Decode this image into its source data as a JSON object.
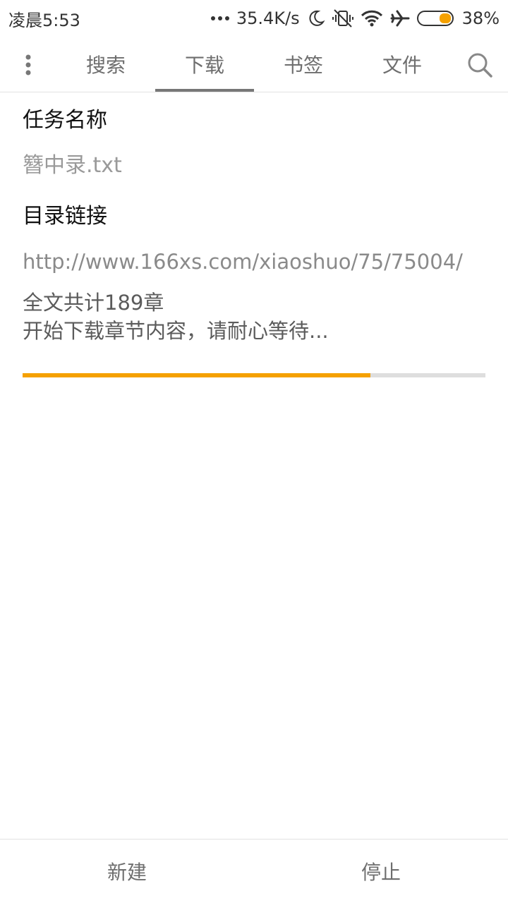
{
  "status_bar": {
    "time": "凌晨5:53",
    "net_speed": "35.4K/s",
    "battery_percent": "38%",
    "battery_level": 0.38,
    "icons": [
      "more-dots-icon",
      "moon-icon",
      "vibrate-off-icon",
      "wifi-icon",
      "airplane-icon",
      "battery-icon"
    ],
    "accent": "#f5a100"
  },
  "tabs": {
    "items": [
      {
        "label": "搜索"
      },
      {
        "label": "下载"
      },
      {
        "label": "书签"
      },
      {
        "label": "文件"
      }
    ],
    "active_index": 1,
    "menu_icon": "more-vertical-icon",
    "search_icon": "search-icon"
  },
  "task": {
    "name_label": "任务名称",
    "name_value": "簪中录.txt",
    "url_label": "目录链接",
    "url_value": "http://www.166xs.com/xiaoshuo/75/75004/",
    "log_line_1": "全文共计189章",
    "log_line_2": "开始下载章节内容，请耐心等待..."
  },
  "progress": {
    "fraction": 0.752,
    "color": "#f5a100"
  },
  "bottom_bar": {
    "new_label": "新建",
    "stop_label": "停止"
  }
}
